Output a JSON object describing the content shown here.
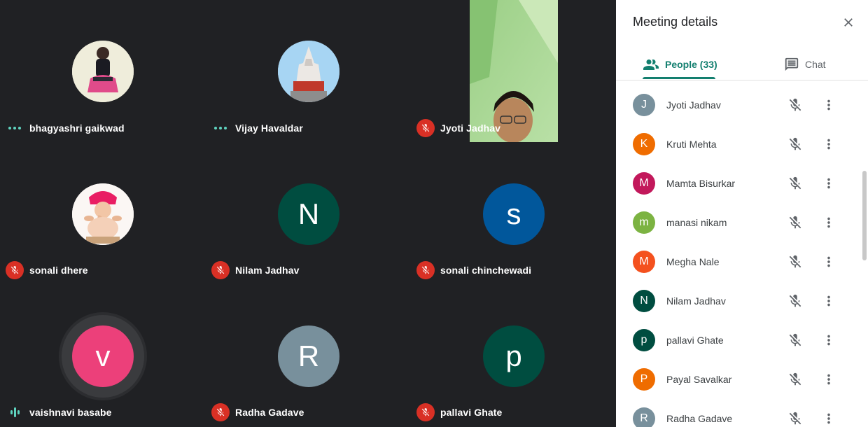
{
  "grid": {
    "tiles": [
      {
        "name": "bhagyashri gaikwad",
        "indicator": "dots",
        "avatar_type": "photo",
        "avatar_photo": "woman-portrait"
      },
      {
        "name": "Vijay Havaldar",
        "indicator": "dots",
        "avatar_type": "photo",
        "avatar_photo": "temple"
      },
      {
        "name": "Jyoti Jadhav",
        "indicator": "muted",
        "avatar_type": "video"
      },
      {
        "name": "sonali dhere",
        "indicator": "muted",
        "avatar_type": "photo",
        "avatar_photo": "ganesha-idol"
      },
      {
        "name": "Nilam Jadhav",
        "indicator": "muted",
        "avatar_type": "letter",
        "letter": "N",
        "color": "#004d40"
      },
      {
        "name": "sonali chinchewadi",
        "indicator": "muted",
        "avatar_type": "letter",
        "letter": "s",
        "color": "#01579b"
      },
      {
        "name": "vaishnavi basabe",
        "indicator": "speaking",
        "avatar_type": "letter",
        "letter": "v",
        "color": "#ec407a"
      },
      {
        "name": "Radha Gadave",
        "indicator": "muted",
        "avatar_type": "letter",
        "letter": "R",
        "color": "#78909c"
      },
      {
        "name": "pallavi Ghate",
        "indicator": "muted",
        "avatar_type": "letter",
        "letter": "p",
        "color": "#004d40"
      }
    ]
  },
  "panel": {
    "title": "Meeting details",
    "close_icon": "close-icon",
    "tabs": [
      {
        "label": "People (33)",
        "icon": "people-icon",
        "active": true
      },
      {
        "label": "Chat",
        "icon": "chat-icon",
        "active": false
      }
    ],
    "accent": "#137f6f",
    "people": [
      {
        "letter": "J",
        "name": "Jyoti Jadhav",
        "color": "#78909c"
      },
      {
        "letter": "K",
        "name": "Kruti Mehta",
        "color": "#ef6c00"
      },
      {
        "letter": "M",
        "name": "Mamta Bisurkar",
        "color": "#c2185b"
      },
      {
        "letter": "m",
        "name": "manasi nikam",
        "color": "#7cb342"
      },
      {
        "letter": "M",
        "name": "Megha Nale",
        "color": "#f4511e"
      },
      {
        "letter": "N",
        "name": "Nilam Jadhav",
        "color": "#004d40"
      },
      {
        "letter": "p",
        "name": "pallavi Ghate",
        "color": "#004d40"
      },
      {
        "letter": "P",
        "name": "Payal Savalkar",
        "color": "#ef6c00"
      },
      {
        "letter": "R",
        "name": "Radha Gadave",
        "color": "#78909c"
      }
    ]
  }
}
